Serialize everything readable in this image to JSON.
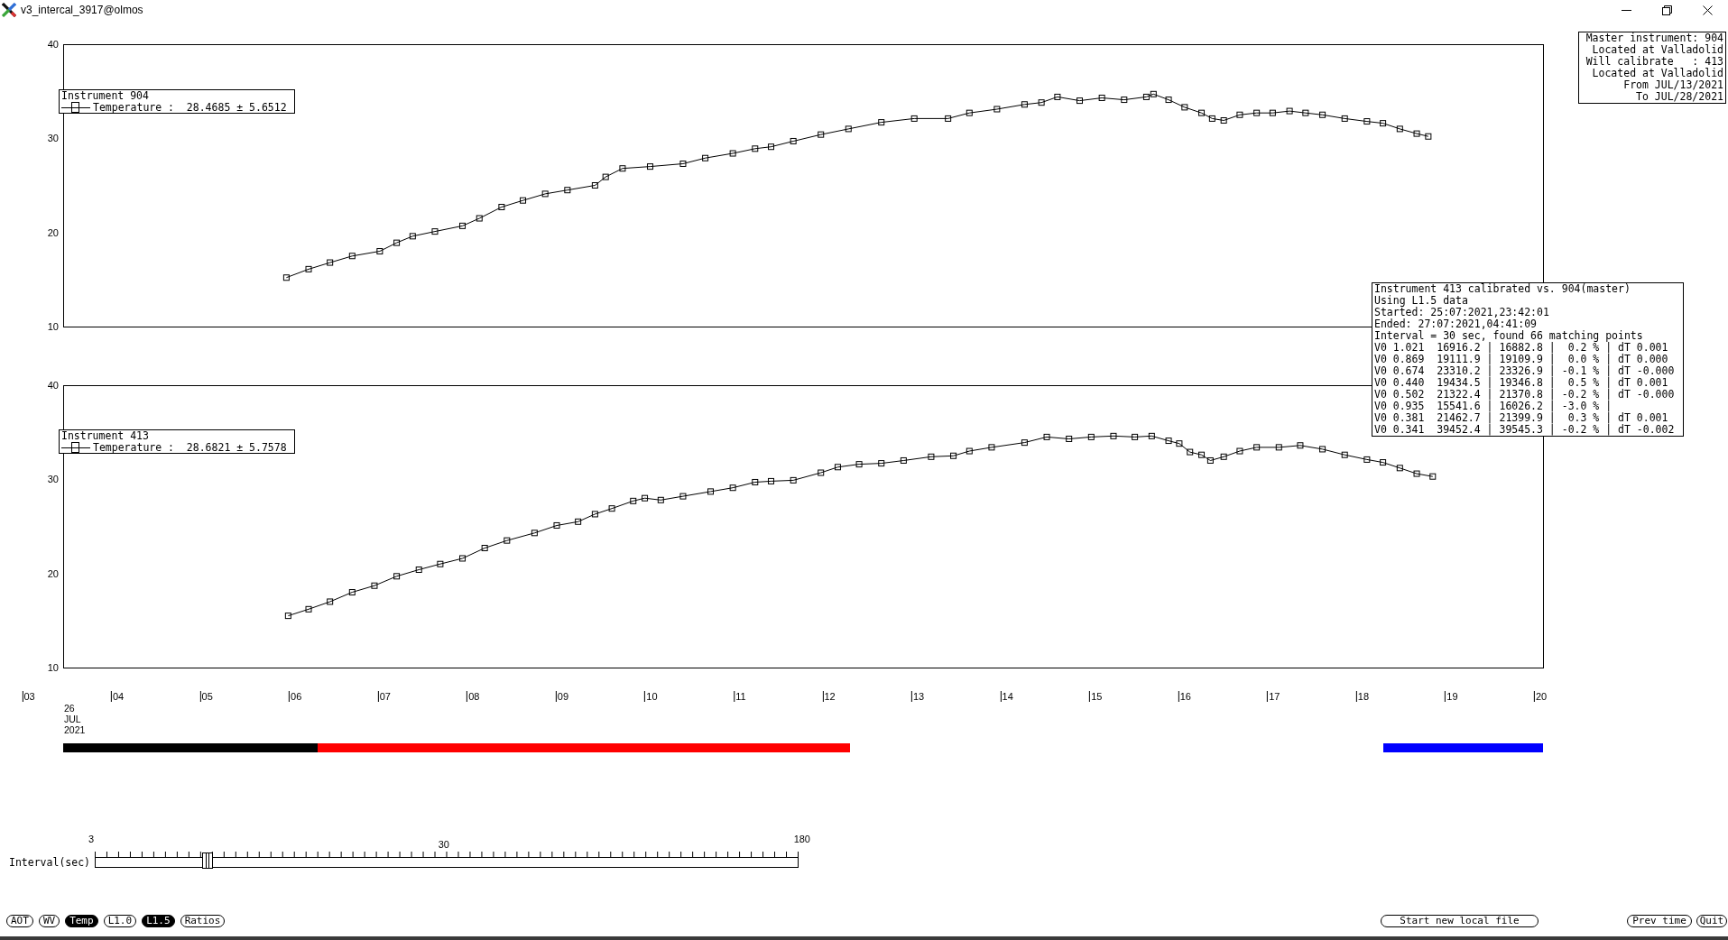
{
  "window": {
    "title": "v3_intercal_3917@olmos"
  },
  "charts": [
    {
      "legend": {
        "title": "Instrument 904",
        "entry": "Temperature :  28.4685 ± 5.6512"
      },
      "chart_data": {
        "type": "line",
        "marker": "square",
        "x": [
          5.9,
          6.15,
          6.39,
          6.64,
          6.95,
          7.14,
          7.32,
          7.57,
          7.88,
          8.07,
          8.32,
          8.56,
          8.81,
          9.06,
          9.37,
          9.49,
          9.68,
          9.99,
          10.36,
          10.61,
          10.92,
          11.17,
          11.35,
          11.6,
          11.91,
          12.22,
          12.59,
          12.96,
          13.34,
          13.58,
          13.89,
          14.2,
          14.39,
          14.57,
          14.82,
          15.07,
          15.32,
          15.57,
          15.65,
          15.82,
          16.0,
          16.19,
          16.31,
          16.44,
          16.62,
          16.81,
          16.99,
          17.18,
          17.36,
          17.55,
          17.8,
          18.05,
          18.23,
          18.42,
          18.61,
          18.74
        ],
        "values": [
          15.2,
          16.1,
          16.8,
          17.5,
          18.0,
          18.9,
          19.6,
          20.1,
          20.7,
          21.5,
          22.7,
          23.4,
          24.1,
          24.5,
          25.0,
          25.9,
          26.8,
          27.0,
          27.3,
          27.9,
          28.4,
          28.9,
          29.1,
          29.7,
          30.4,
          31.0,
          31.7,
          32.1,
          32.1,
          32.7,
          33.1,
          33.6,
          33.8,
          34.4,
          34.0,
          34.3,
          34.1,
          34.4,
          34.7,
          34.1,
          33.3,
          32.7,
          32.1,
          31.9,
          32.5,
          32.7,
          32.7,
          32.9,
          32.7,
          32.5,
          32.1,
          31.8,
          31.6,
          31.0,
          30.5,
          30.2
        ],
        "xlim": [
          3.39,
          20.03
        ],
        "ylim": [
          10,
          40
        ],
        "yticks": [
          10,
          20,
          30,
          40
        ]
      }
    },
    {
      "legend": {
        "title": "Instrument 413",
        "entry": "Temperature :  28.6821 ± 5.7578"
      },
      "chart_data": {
        "type": "line",
        "marker": "square",
        "x": [
          5.92,
          6.15,
          6.39,
          6.64,
          6.89,
          7.14,
          7.39,
          7.63,
          7.88,
          8.13,
          8.38,
          8.69,
          8.94,
          9.18,
          9.37,
          9.56,
          9.8,
          9.93,
          10.11,
          10.36,
          10.67,
          10.92,
          11.17,
          11.35,
          11.6,
          11.91,
          12.1,
          12.34,
          12.59,
          12.84,
          13.15,
          13.4,
          13.58,
          13.83,
          14.2,
          14.45,
          14.7,
          14.95,
          15.2,
          15.44,
          15.63,
          15.82,
          15.94,
          16.06,
          16.19,
          16.29,
          16.44,
          16.62,
          16.81,
          17.06,
          17.3,
          17.55,
          17.8,
          18.05,
          18.23,
          18.42,
          18.61,
          18.79
        ],
        "values": [
          15.5,
          16.2,
          17.0,
          18.0,
          18.7,
          19.7,
          20.4,
          21.0,
          21.6,
          22.7,
          23.5,
          24.3,
          25.1,
          25.5,
          26.3,
          26.9,
          27.7,
          28.0,
          27.8,
          28.2,
          28.7,
          29.1,
          29.7,
          29.8,
          29.9,
          30.7,
          31.3,
          31.6,
          31.7,
          32.0,
          32.4,
          32.5,
          33.0,
          33.4,
          33.9,
          34.5,
          34.3,
          34.5,
          34.6,
          34.5,
          34.6,
          34.1,
          33.8,
          32.9,
          32.6,
          32.0,
          32.4,
          33.0,
          33.4,
          33.4,
          33.6,
          33.2,
          32.6,
          32.1,
          31.8,
          31.2,
          30.6,
          30.3
        ],
        "xlim": [
          3.39,
          20.03
        ],
        "ylim": [
          10,
          40
        ],
        "yticks": [
          10,
          20,
          30,
          40
        ],
        "xticks": [
          {
            "value": 4,
            "label": "04"
          },
          {
            "value": 5,
            "label": "05"
          },
          {
            "value": 6,
            "label": "06"
          },
          {
            "value": 7,
            "label": "07"
          },
          {
            "value": 8,
            "label": "08"
          },
          {
            "value": 9,
            "label": "09"
          },
          {
            "value": 10,
            "label": "10"
          },
          {
            "value": 11,
            "label": "11"
          },
          {
            "value": 12,
            "label": "12"
          },
          {
            "value": 13,
            "label": "13"
          },
          {
            "value": 14,
            "label": "14"
          },
          {
            "value": 15,
            "label": "15"
          },
          {
            "value": 16,
            "label": "16"
          },
          {
            "value": 17,
            "label": "17"
          },
          {
            "value": 18,
            "label": "18"
          },
          {
            "value": 19,
            "label": "19"
          },
          {
            "value": 20,
            "label": "20"
          }
        ]
      },
      "outer_tick": "03",
      "date_label": [
        "26",
        "JUL",
        "2021"
      ],
      "coverage_bars": [
        {
          "color": "#000000"
        },
        {
          "color": "#ff0000"
        },
        {
          "color": "#0000ff"
        }
      ]
    }
  ],
  "master_info": [
    "Master instrument: 904",
    "Located at Valladolid",
    "Will calibrate   : 413",
    "Located at Valladolid",
    "From JUL/13/2021",
    "To JUL/28/2021"
  ],
  "calibration_report": [
    "Instrument 413 calibrated vs. 904(master)",
    "Using L1.5 data",
    "Started: 25:07:2021,23:42:01",
    "Ended: 27:07:2021,04:41:09",
    "Interval = 30 sec, found 66 matching points",
    "V0 1.021  16916.2 | 16882.8 |  0.2 % | dT 0.001",
    "V0 0.869  19111.9 | 19109.9 |  0.0 % | dT 0.000",
    "V0 0.674  23310.2 | 23326.9 | -0.1 % | dT -0.000",
    "V0 0.440  19434.5 | 19346.8 |  0.5 % | dT 0.001",
    "V0 0.502  21322.4 | 21370.8 | -0.2 % | dT -0.000",
    "V0 0.935  15541.6 | 16026.2 | -3.0 % |",
    "V0 0.381  21462.7 | 21399.9 |  0.3 % | dT 0.001",
    "V0 0.341  39452.4 | 39545.3 | -0.2 % | dT -0.002"
  ],
  "interval_slider": {
    "label": "Interval(sec)",
    "scale_labels": [
      "3",
      "30",
      "180"
    ],
    "level": 0.159
  },
  "data_buttons": [
    {
      "label": "AOT",
      "selected": false
    },
    {
      "label": "WV",
      "selected": false
    },
    {
      "label": "Temp",
      "selected": true
    },
    {
      "label": "L1.0",
      "selected": false
    },
    {
      "label": "L1.5",
      "selected": true
    },
    {
      "label": "Ratios",
      "selected": false
    }
  ],
  "actions": [
    "Start new local file",
    "Prev time",
    "Quit"
  ]
}
